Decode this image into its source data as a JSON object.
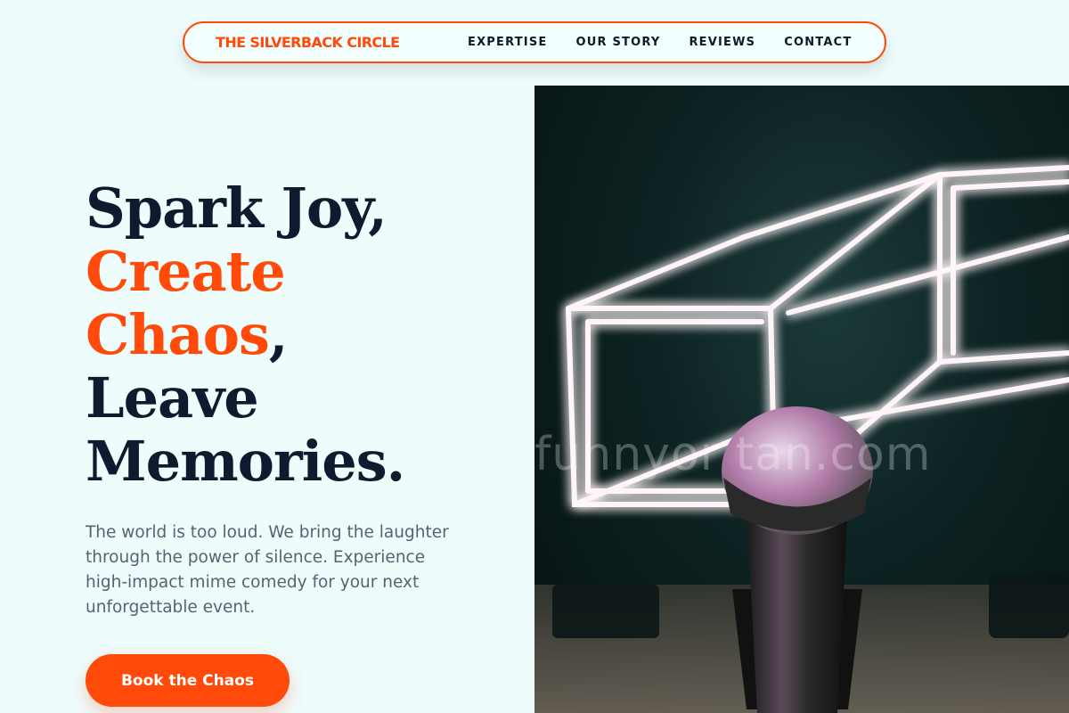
{
  "nav": {
    "brand": "THE SILVERBACK CIRCLE",
    "links": [
      "EXPERTISE",
      "OUR STORY",
      "REVIEWS",
      "CONTACT"
    ]
  },
  "hero": {
    "headline": {
      "line1": "Spark Joy,",
      "line2": "Create",
      "line3_accent": "Chaos",
      "line3_rest": ",",
      "line4": "Leave",
      "line5": "Memories."
    },
    "subtext": "The world is too loud. We bring the laughter through the power of silence. Experience high-impact mime comedy for your next unforgettable event.",
    "cta_label": "Book the Chaos",
    "image": {
      "description_icon": "microphone-stage-image",
      "watermark": "funnyor  tan.com"
    }
  },
  "colors": {
    "accent": "#ff4a0a",
    "dark": "#0f1a2e",
    "background": "#eefcfc"
  }
}
